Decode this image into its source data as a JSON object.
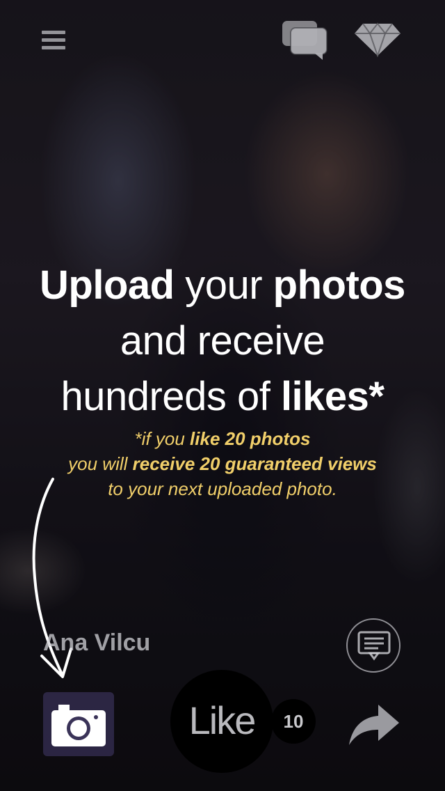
{
  "header": {
    "menu_icon": "menu-icon",
    "messages_icon": "chat-bubbles-icon",
    "premium_icon": "diamond-icon"
  },
  "promo": {
    "line1": {
      "bold1": "Upload",
      "light1": " your ",
      "bold2": "photos"
    },
    "line2": "and receive",
    "line3": {
      "light": "hundreds of ",
      "bold": "likes*"
    },
    "note": {
      "line1_light": "*if you ",
      "line1_bold": "like 20 photos",
      "line2_light": "you will ",
      "line2_bold": "receive 20 guaranteed views",
      "line3": "to your next uploaded photo."
    },
    "accent_color": "#f1cf6a"
  },
  "photo": {
    "user_name": "Ana Vilcu"
  },
  "actions": {
    "camera_icon": "camera-icon",
    "comment_icon": "comment-icon",
    "like_label": "Like",
    "like_count": "10",
    "share_icon": "share-arrow-icon"
  }
}
